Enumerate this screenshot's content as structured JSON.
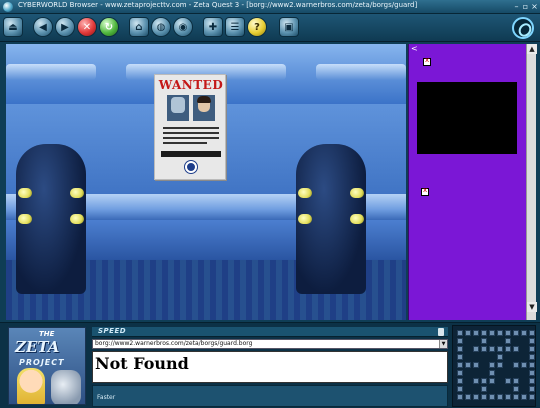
{
  "window": {
    "title": "CYBERWORLD Browser - www.zetaprojecttv.com - Zeta Quest 3 - [borg://www2.warnerbros.com/zeta/borgs/guard]",
    "minimize": "–",
    "restore": "▫",
    "close": "×"
  },
  "toolbar": {
    "buttons": [
      {
        "name": "exit-icon",
        "glyph": "⏏"
      },
      {
        "name": "back-icon",
        "glyph": "◀"
      },
      {
        "name": "forward-icon",
        "glyph": "▶"
      },
      {
        "name": "stop-icon",
        "glyph": "✕"
      },
      {
        "name": "refresh-icon",
        "glyph": "↻"
      },
      {
        "name": "home-icon",
        "glyph": "⌂"
      },
      {
        "name": "globe-icon",
        "glyph": "◍"
      },
      {
        "name": "history-icon",
        "glyph": "◉"
      },
      {
        "name": "bookmark-icon",
        "glyph": "✚"
      },
      {
        "name": "list-icon",
        "glyph": "☰"
      },
      {
        "name": "help-icon",
        "glyph": "?"
      },
      {
        "name": "settings-icon",
        "glyph": "▣"
      }
    ]
  },
  "scene": {
    "poster_title": "WANTED"
  },
  "side_panel": {
    "corner_glyph": "<"
  },
  "scrollbar": {
    "up": "▲",
    "down": "▼"
  },
  "bottom": {
    "logo_the": "THE",
    "logo_name": "ZETA",
    "logo_project": "PROJECT",
    "speed_label": "SPEED",
    "url": "borg://www2.warnerbros.com/zeta/borgs/guard.borg",
    "url_dropdown": "▼",
    "document_heading": "Not Found",
    "status": "Faster"
  },
  "colors": {
    "accent": "#7b17d6",
    "title_bar": "#2f6f8f",
    "wanted_red": "#c41818"
  }
}
